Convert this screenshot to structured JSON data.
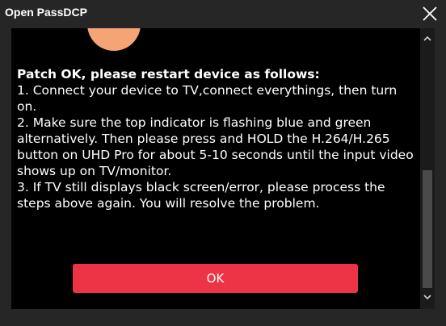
{
  "window": {
    "title": "Open PassDCP"
  },
  "dialog": {
    "heading": "Patch OK, please restart device as follows:",
    "lines": [
      "1. Connect your device to TV,connect everythings, then turn on.",
      "2. Make sure the top indicator is flashing blue and green alternatively. Then please press and HOLD the H.264/H.265 button on UHD Pro for about 5-10 seconds until the input video shows up on TV/monitor.",
      "3. If TV still displays black screen/error, please process the steps above again. You will resolve the problem."
    ],
    "ok_label": "OK"
  },
  "icons": {
    "close": "close-icon",
    "scroll_up": "chevron-up-icon",
    "scroll_down": "chevron-down-icon"
  },
  "colors": {
    "title_bar": "#262626",
    "content_bg": "#000000",
    "ok_button": "#ed3447",
    "illustration": "#f5a475"
  }
}
